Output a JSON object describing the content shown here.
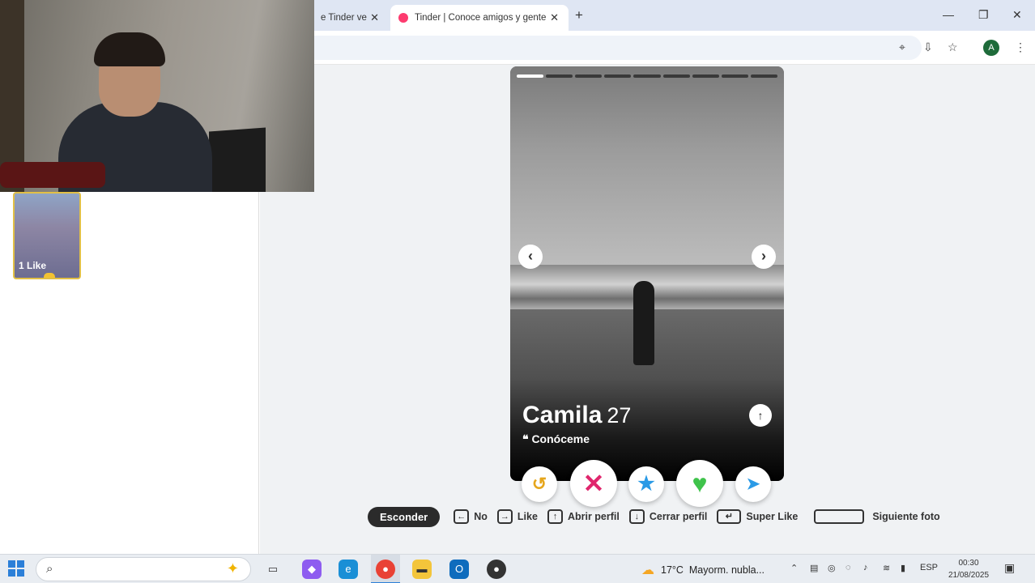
{
  "browser": {
    "tabs": [
      {
        "label": "e Tinder ve",
        "active": false
      },
      {
        "label": "Tinder | Conoce amigos y gente",
        "active": true
      }
    ],
    "new_tab": "+",
    "profile_initial": "A"
  },
  "sidebar": {
    "likes_label": "1 Like"
  },
  "profile": {
    "name": "Camila",
    "age": "27",
    "tagline": "Conóceme",
    "photo_count": 9,
    "current_photo": 1
  },
  "actions": {
    "rewind": "rewind-icon",
    "nope": "close-icon",
    "super_like": "star-icon",
    "like": "heart-icon",
    "boost": "send-icon"
  },
  "shortcuts": {
    "hide_label": "Esconder",
    "no_label": "No",
    "like_label": "Like",
    "open_profile_label": "Abrir perfil",
    "close_profile_label": "Cerrar perfil",
    "super_like_label": "Super Like",
    "next_photo_label": "Siguiente foto"
  },
  "taskbar": {
    "weather_temp": "17°C",
    "weather_text": "Mayorm. nubla...",
    "language": "ESP",
    "time": "00:30",
    "date": "21/08/2025"
  },
  "colors": {
    "tinder_brand": "#fd3b6f",
    "nope": "#e0266d",
    "like": "#3fc34b",
    "super_like": "#2a9ae6",
    "rewind": "#e6a61c",
    "like_card_border": "#e2c046"
  }
}
